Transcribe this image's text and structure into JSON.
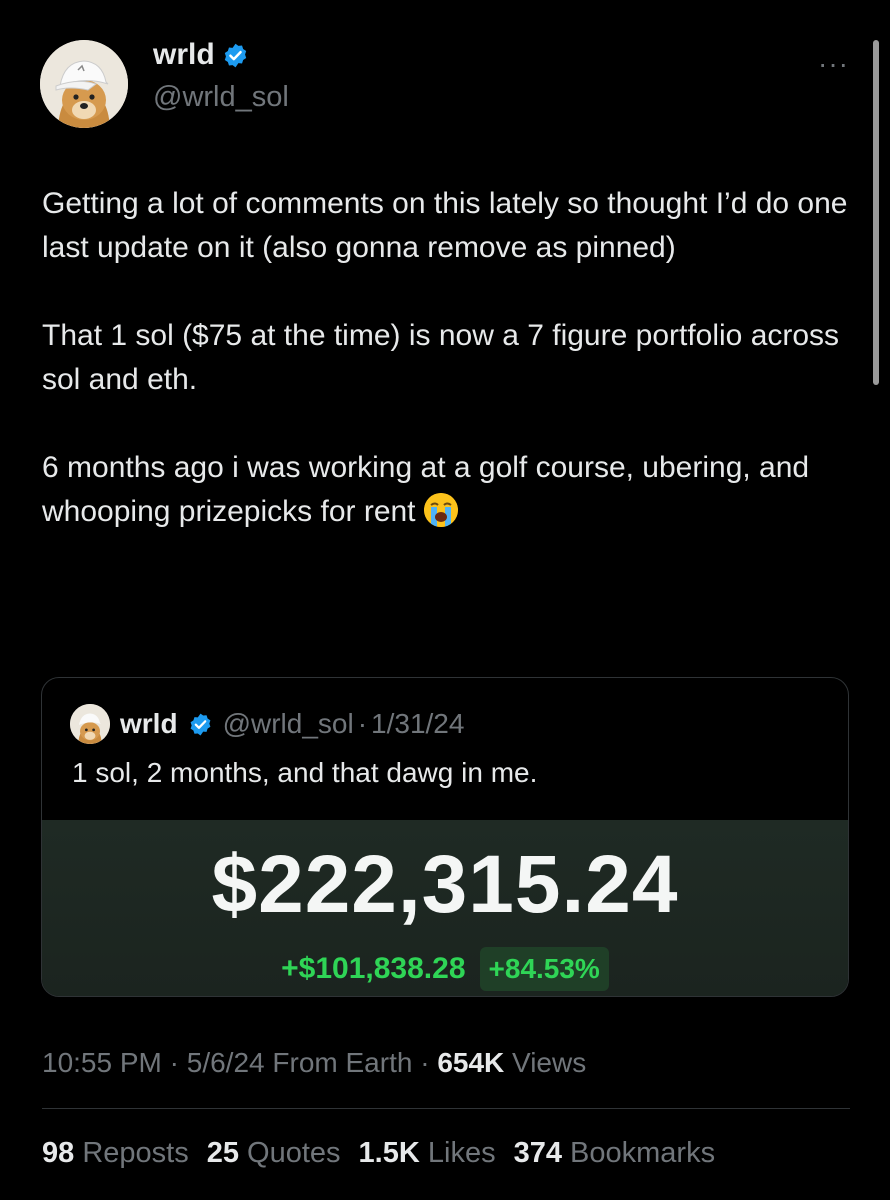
{
  "author": {
    "name": "wrld",
    "handle": "@wrld_sol",
    "verified_color": "#1d9bf0"
  },
  "more_label": "···",
  "tweet": {
    "paragraphs": [
      "Getting a lot of comments on this lately so thought I’d do one last update on it (also gonna remove as pinned)",
      "That 1 sol ($75 at the time) is now a 7 figure portfolio across sol and eth.",
      "6 months ago i was working at a golf course, ubering, and whooping prizepicks for rent"
    ],
    "emoji": "loudly-crying-face"
  },
  "quote": {
    "name": "wrld",
    "handle": "@wrld_sol",
    "date": "1/31/24",
    "text": "1 sol, 2 months, and that dawg in me.",
    "media": {
      "balance": "$222,315.24",
      "change": "+$101,838.28",
      "percent": "+84.53%",
      "accent": "#2fd556"
    }
  },
  "meta": {
    "time": "10:55 PM",
    "date": "5/6/24",
    "source": "From Earth",
    "views_count": "654K",
    "views_label": "Views"
  },
  "stats": {
    "reposts_count": "98",
    "reposts_label": "Reposts",
    "quotes_count": "25",
    "quotes_label": "Quotes",
    "likes_count": "1.5K",
    "likes_label": "Likes",
    "bookmarks_count": "374",
    "bookmarks_label": "Bookmarks"
  }
}
